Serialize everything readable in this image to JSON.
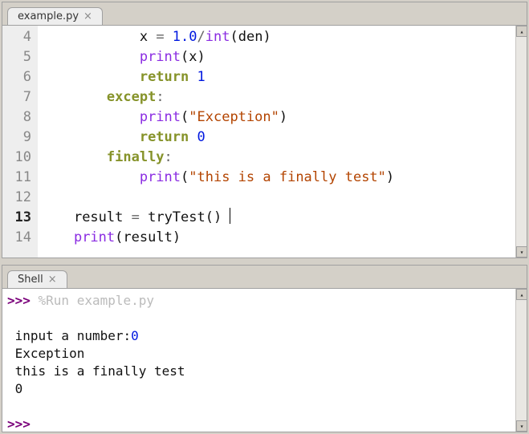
{
  "editor": {
    "tab": "example.py",
    "first_line": 4,
    "current_line": 13,
    "lines": {
      "4": {
        "segs": [
          [
            "",
            "            "
          ],
          [
            "id",
            "x"
          ],
          [
            "op",
            " = "
          ],
          [
            "num",
            "1.0"
          ],
          [
            "op",
            "/"
          ],
          [
            "bi",
            "int"
          ],
          [
            "par",
            "("
          ],
          [
            "id",
            "den"
          ],
          [
            "par",
            ")"
          ]
        ]
      },
      "5": {
        "segs": [
          [
            "",
            "            "
          ],
          [
            "bi",
            "print"
          ],
          [
            "par",
            "("
          ],
          [
            "id",
            "x"
          ],
          [
            "par",
            ")"
          ]
        ]
      },
      "6": {
        "segs": [
          [
            "",
            "            "
          ],
          [
            "kw",
            "return"
          ],
          [
            "",
            " "
          ],
          [
            "num",
            "1"
          ]
        ]
      },
      "7": {
        "segs": [
          [
            "",
            "        "
          ],
          [
            "kw",
            "except"
          ],
          [
            "col",
            ":"
          ]
        ]
      },
      "8": {
        "segs": [
          [
            "",
            "            "
          ],
          [
            "bi",
            "print"
          ],
          [
            "par",
            "("
          ],
          [
            "str",
            "\"Exception\""
          ],
          [
            "par",
            ")"
          ]
        ]
      },
      "9": {
        "segs": [
          [
            "",
            "            "
          ],
          [
            "kw",
            "return"
          ],
          [
            "",
            " "
          ],
          [
            "num",
            "0"
          ]
        ]
      },
      "10": {
        "segs": [
          [
            "",
            "        "
          ],
          [
            "kw",
            "finally"
          ],
          [
            "col",
            ":"
          ]
        ]
      },
      "11": {
        "segs": [
          [
            "",
            "            "
          ],
          [
            "bi",
            "print"
          ],
          [
            "par",
            "("
          ],
          [
            "str",
            "\"this is a finally test\""
          ],
          [
            "par",
            ")"
          ]
        ]
      },
      "12": {
        "segs": [
          [
            "",
            ""
          ]
        ]
      },
      "13": {
        "segs": [
          [
            "",
            "    "
          ],
          [
            "id",
            "result"
          ],
          [
            "op",
            " = "
          ],
          [
            "id",
            "tryTest"
          ],
          [
            "par",
            "()"
          ]
        ],
        "cursor": true
      },
      "14": {
        "segs": [
          [
            "",
            "    "
          ],
          [
            "bi",
            "print"
          ],
          [
            "par",
            "("
          ],
          [
            "id",
            "result"
          ],
          [
            "par",
            ")"
          ]
        ]
      }
    }
  },
  "shell": {
    "tab": "Shell",
    "prompt": ">>>",
    "run_cmd": "%Run example.py",
    "output": [
      {
        "segs": [
          [
            "",
            " input a number:"
          ],
          [
            "inval",
            "0"
          ]
        ]
      },
      {
        "segs": [
          [
            "",
            " Exception"
          ]
        ]
      },
      {
        "segs": [
          [
            "",
            " this is a finally test"
          ]
        ]
      },
      {
        "segs": [
          [
            "",
            " 0"
          ]
        ]
      }
    ]
  }
}
